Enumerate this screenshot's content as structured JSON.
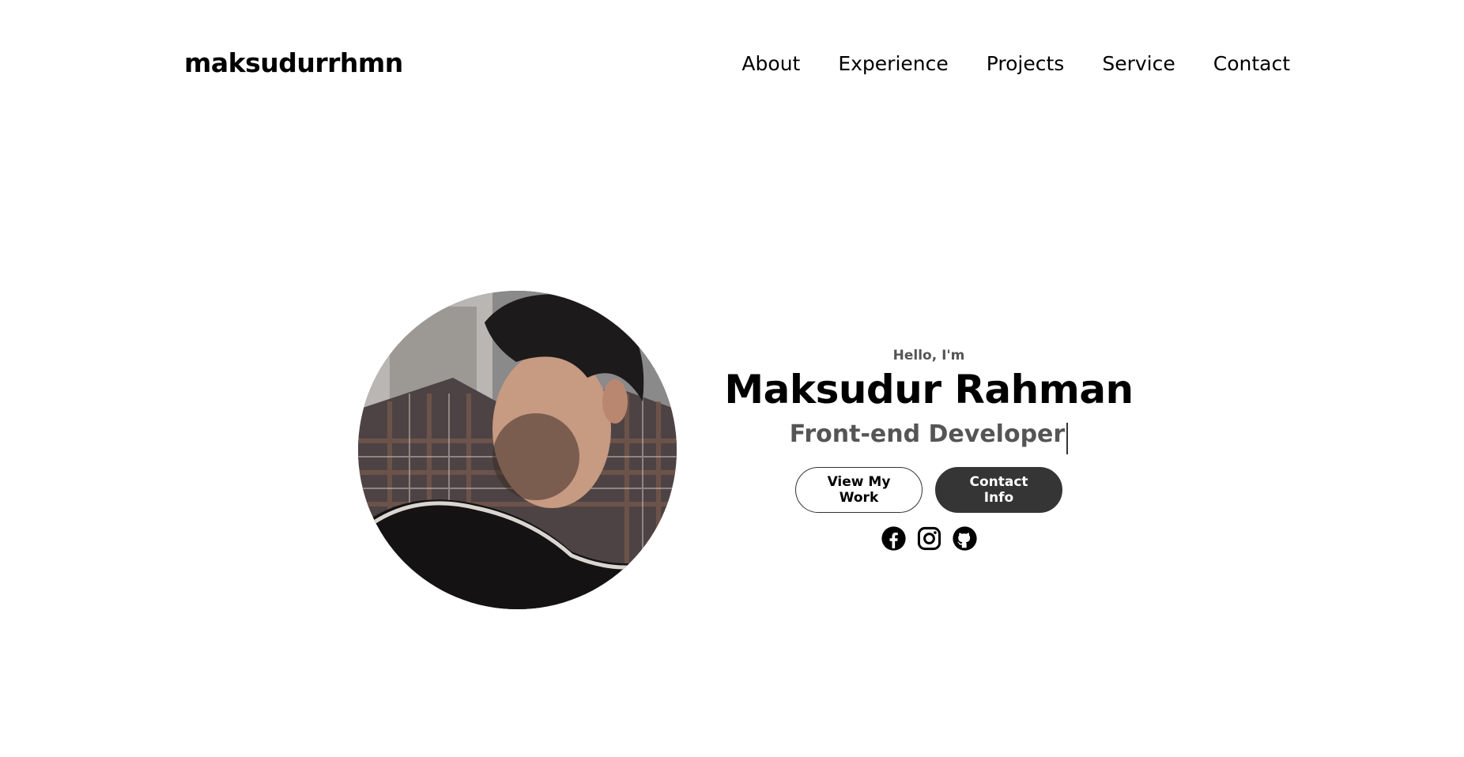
{
  "nav": {
    "logo": "maksudurrhmn",
    "links": [
      {
        "label": "About"
      },
      {
        "label": "Experience"
      },
      {
        "label": "Projects"
      },
      {
        "label": "Service"
      },
      {
        "label": "Contact"
      }
    ]
  },
  "hero": {
    "greeting": "Hello, I'm",
    "name": "Maksudur Rahman",
    "role": "Front-end Developer",
    "buttons": {
      "view_work": "View My Work",
      "contact_info": "Contact Info"
    },
    "socials": [
      {
        "icon": "facebook-icon"
      },
      {
        "icon": "instagram-icon"
      },
      {
        "icon": "github-icon"
      }
    ]
  },
  "colors": {
    "text": "#000000",
    "muted": "#555555",
    "button_dark": "#353535",
    "background": "#ffffff"
  }
}
